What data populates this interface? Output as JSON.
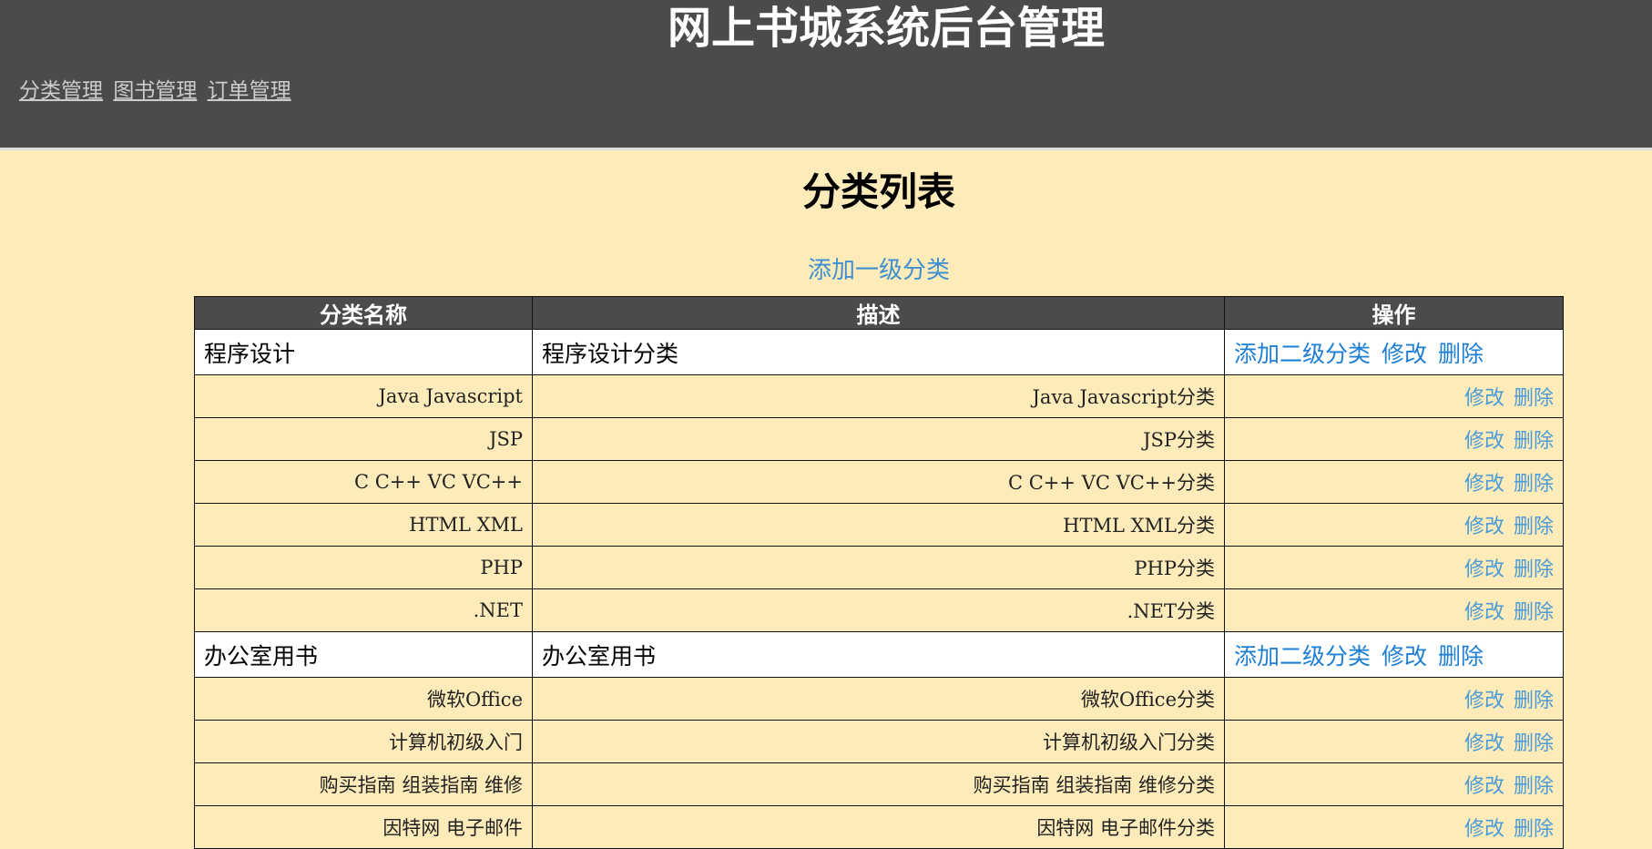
{
  "header": {
    "title": "网上书城系统后台管理",
    "nav": [
      "分类管理",
      "图书管理",
      "订单管理"
    ]
  },
  "main": {
    "title": "分类列表",
    "add_top_label": "添加一级分类",
    "columns": [
      "分类名称",
      "描述",
      "操作"
    ],
    "rows": [
      {
        "level": 1,
        "name": "程序设计",
        "desc": "程序设计分类",
        "actions": [
          "添加二级分类",
          "修改",
          "删除"
        ]
      },
      {
        "level": 2,
        "name": "Java Javascript",
        "desc": "Java Javascript分类",
        "actions": [
          "修改",
          "删除"
        ]
      },
      {
        "level": 2,
        "name": "JSP",
        "desc": "JSP分类",
        "actions": [
          "修改",
          "删除"
        ]
      },
      {
        "level": 2,
        "name": "C C++ VC VC++",
        "desc": "C C++ VC VC++分类",
        "actions": [
          "修改",
          "删除"
        ]
      },
      {
        "level": 2,
        "name": "HTML XML",
        "desc": "HTML XML分类",
        "actions": [
          "修改",
          "删除"
        ]
      },
      {
        "level": 2,
        "name": "PHP",
        "desc": "PHP分类",
        "actions": [
          "修改",
          "删除"
        ]
      },
      {
        "level": 2,
        "name": ".NET",
        "desc": ".NET分类",
        "actions": [
          "修改",
          "删除"
        ]
      },
      {
        "level": 1,
        "name": "办公室用书",
        "desc": "办公室用书",
        "actions": [
          "添加二级分类",
          "修改",
          "删除"
        ]
      },
      {
        "level": 2,
        "name": "微软Office",
        "desc": "微软Office分类",
        "actions": [
          "修改",
          "删除"
        ]
      },
      {
        "level": 2,
        "name": "计算机初级入门",
        "desc": "计算机初级入门分类",
        "actions": [
          "修改",
          "删除"
        ]
      },
      {
        "level": 2,
        "name": "购买指南 组装指南 维修",
        "desc": "购买指南 组装指南 维修分类",
        "actions": [
          "修改",
          "删除"
        ]
      },
      {
        "level": 2,
        "name": "因特网 电子邮件",
        "desc": "因特网 电子邮件分类",
        "actions": [
          "修改",
          "删除"
        ]
      }
    ]
  },
  "colors": {
    "header_bg": "#4b4b4b",
    "page_bg": "#fdebba",
    "link_blue": "#1e7ed4"
  }
}
